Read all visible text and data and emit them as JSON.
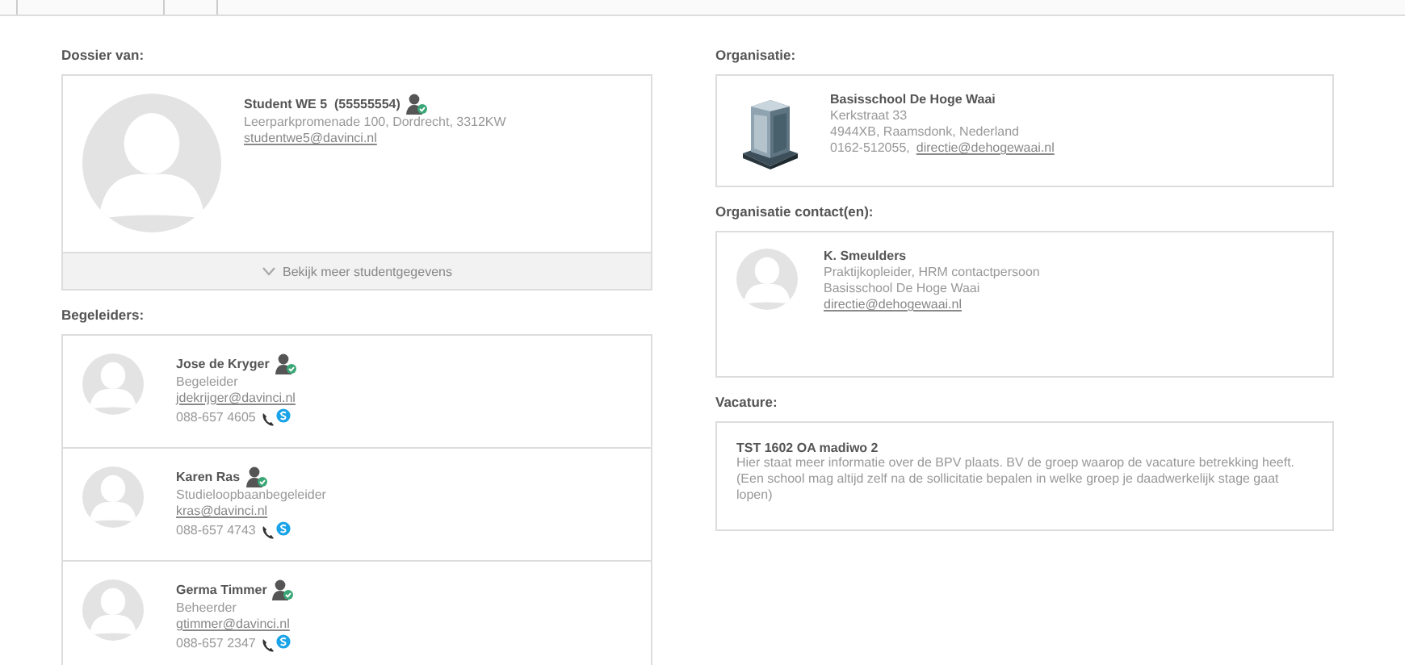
{
  "student": {
    "heading": "Dossier van:",
    "name": "Student WE 5  (55555554)",
    "address": "Leerparkpromenade 100, Dordrecht, 3312KW",
    "email": "studentwe5@davinci.nl",
    "more_link": "Bekijk meer studentgegevens"
  },
  "begeleiders": {
    "heading": "Begeleiders:",
    "items": [
      {
        "name": "Jose de Kryger",
        "role": "Begeleider",
        "email": "jdekrijger@davinci.nl",
        "phone": "088-657 4605"
      },
      {
        "name": "Karen Ras",
        "role": "Studieloopbaanbegeleider",
        "email": "kras@davinci.nl",
        "phone": "088-657 4743"
      },
      {
        "name": "Germa Timmer",
        "role": "Beheerder",
        "email": "gtimmer@davinci.nl",
        "phone": "088-657 2347"
      }
    ]
  },
  "organisatie": {
    "heading": "Organisatie:",
    "name": "Basisschool De Hoge Waai",
    "street": "Kerkstraat 33",
    "city": "4944XB, Raamsdonk, Nederland",
    "phone": "0162-512055,",
    "email": "directie@dehogewaai.nl"
  },
  "contacts": {
    "heading": "Organisatie contact(en):",
    "items": [
      {
        "name": "K. Smeulders",
        "role": "Praktijkopleider, HRM contactpersoon",
        "organisation": "Basisschool De Hoge Waai",
        "email": "directie@dehogewaai.nl"
      }
    ]
  },
  "vacature": {
    "heading": "Vacature:",
    "title": "TST 1602 OA madiwo 2",
    "description": "Hier staat meer informatie over de BPV plaats. BV de groep waarop de vacature betrekking heeft. (Een school mag altijd zelf na de sollicitatie bepalen in welke groep je daadwerkelijk stage gaat lopen)"
  }
}
